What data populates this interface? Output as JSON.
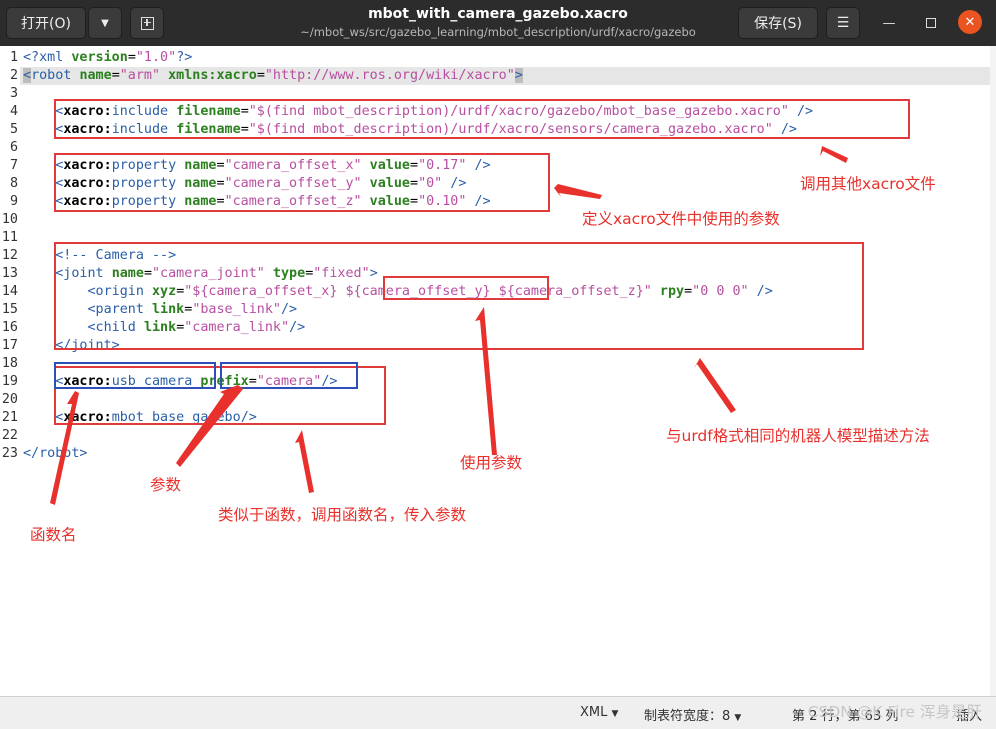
{
  "header": {
    "open_label": "打开(O)",
    "save_label": "保存(S)",
    "title": "mbot_with_camera_gazebo.xacro",
    "path": "~/mbot_ws/src/gazebo_learning/mbot_description/urdf/xacro/gazebo"
  },
  "annotations": {
    "call_other": "调用其他xacro文件",
    "define_params": "定义xacro文件中使用的参数",
    "urdf_same": "与urdf格式相同的机器人模型描述方法",
    "use_param": "使用参数",
    "param": "参数",
    "like_function": "类似于函数，调用函数名，传入参数",
    "func_name": "函数名"
  },
  "status": {
    "language": "XML",
    "tab_width": "制表符宽度：8",
    "position": "第 2 行，第 63 列",
    "mode": "插入"
  },
  "watermark": "CSDN @K Fire 浑身是肝",
  "code": {
    "l1": [
      "<?xml ",
      "version",
      "=",
      "\"1.0\"",
      "?>"
    ],
    "l2": [
      "<",
      "robot ",
      "name",
      "=",
      "\"arm\"",
      " xmlns:xacro",
      "=",
      "\"http://www.ros.org/wiki/xacro\"",
      ">"
    ],
    "l4": [
      "    <",
      "xacro:",
      "include ",
      "filename",
      "=",
      "\"$(find mbot_description)/urdf/xacro/gazebo/mbot_base_gazebo.xacro\"",
      " />"
    ],
    "l5": [
      "    <",
      "xacro:",
      "include ",
      "filename",
      "=",
      "\"$(find mbot_description)/urdf/xacro/sensors/camera_gazebo.xacro\"",
      " />"
    ],
    "l7": [
      "    <",
      "xacro:",
      "property ",
      "name",
      "=",
      "\"camera_offset_x\"",
      " value",
      "=",
      "\"0.17\"",
      " />"
    ],
    "l8": [
      "    <",
      "xacro:",
      "property ",
      "name",
      "=",
      "\"camera_offset_y\"",
      " value",
      "=",
      "\"0\"",
      " />"
    ],
    "l9": [
      "    <",
      "xacro:",
      "property ",
      "name",
      "=",
      "\"camera_offset_z\"",
      " value",
      "=",
      "\"0.10\"",
      " />"
    ],
    "l12": "    <!-- Camera -->",
    "l13": [
      "    <joint ",
      "name",
      "=",
      "\"camera_joint\"",
      " type",
      "=",
      "\"fixed\"",
      ">"
    ],
    "l14": [
      "        <origin ",
      "xyz",
      "=",
      "\"${camera_offset_x} ${camera_offset_y} ${camera_offset_z}\"",
      " rpy",
      "=",
      "\"0 0 0\"",
      " />"
    ],
    "l15": [
      "        <parent ",
      "link",
      "=",
      "\"base_link\"",
      "/>"
    ],
    "l16": [
      "        <child ",
      "link",
      "=",
      "\"camera_link\"",
      "/>"
    ],
    "l17": "    </joint>",
    "l19": [
      "    <",
      "xacro:",
      "usb_camera ",
      "prefix",
      "=",
      "\"camera\"",
      "/>"
    ],
    "l21": [
      "    <",
      "xacro:",
      "mbot_base_gazebo",
      "/>"
    ],
    "l23": "</robot>"
  }
}
